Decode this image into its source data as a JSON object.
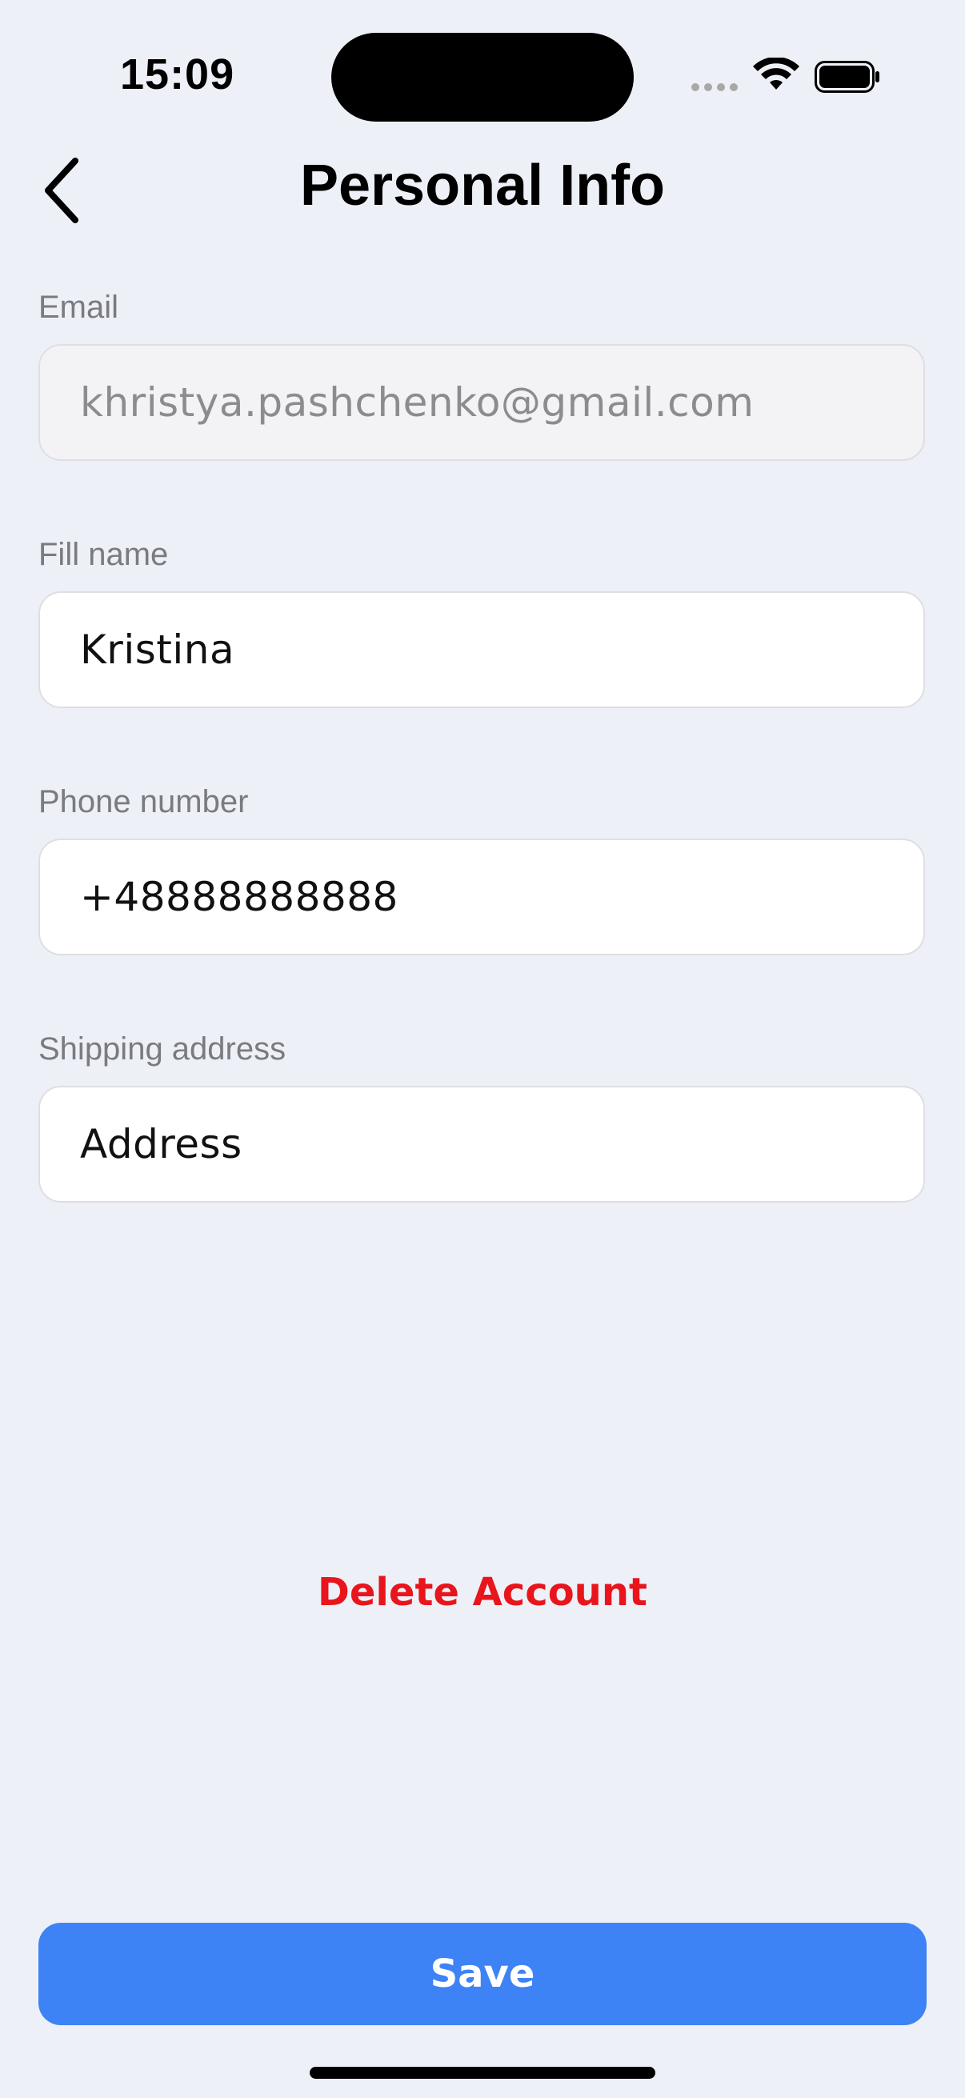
{
  "status_bar": {
    "time": "15:09",
    "icons": [
      "signal-dots-icon",
      "wifi-icon",
      "battery-icon"
    ]
  },
  "header": {
    "back_icon": "chevron-left-icon",
    "title": "Personal Info"
  },
  "form": {
    "email": {
      "label": "Email",
      "value": "khristya.pashchenko@gmail.com"
    },
    "full_name": {
      "label": "Fill name",
      "value": "Kristina"
    },
    "phone": {
      "label": "Phone number",
      "value": "+48888888888"
    },
    "address": {
      "label": "Shipping address",
      "value": "Address"
    }
  },
  "actions": {
    "delete_label": "Delete Account",
    "save_label": "Save"
  },
  "colors": {
    "background": "#edf0f7",
    "accent": "#3d83f5",
    "danger": "#e8151d"
  }
}
